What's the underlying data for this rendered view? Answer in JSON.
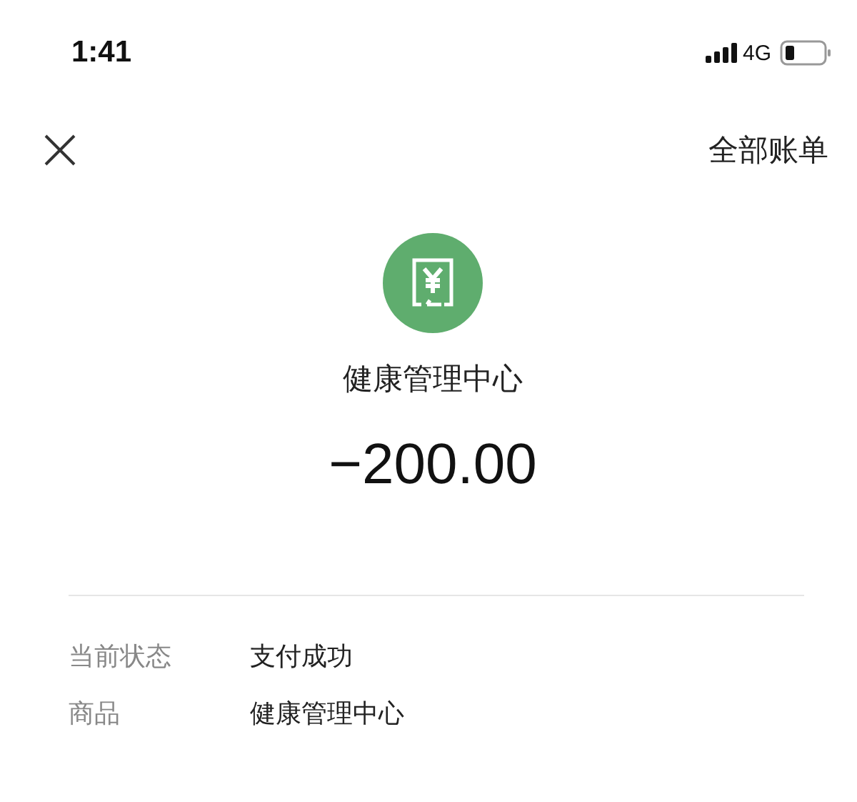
{
  "status_bar": {
    "time": "1:41",
    "network": "4G"
  },
  "nav": {
    "action": "全部账单"
  },
  "payment": {
    "merchant": "健康管理中心",
    "amount": "−200.00"
  },
  "details": [
    {
      "label": "当前状态",
      "value": "支付成功"
    },
    {
      "label": "商品",
      "value": "健康管理中心"
    }
  ]
}
